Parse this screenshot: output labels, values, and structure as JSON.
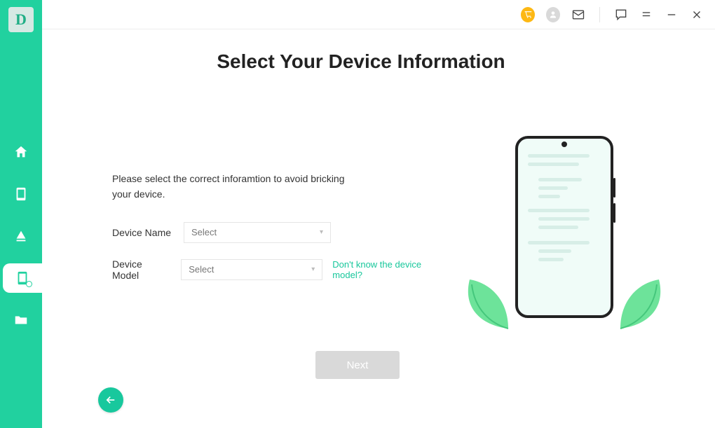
{
  "logo_letter": "D",
  "header": {
    "title": "Select Your Device Information"
  },
  "form": {
    "instruction": "Please select the correct inforamtion to avoid bricking your device.",
    "device_name_label": "Device Name",
    "device_name_value": "Select",
    "device_model_label": "Device Model",
    "device_model_value": "Select",
    "help_link_text": "Don't know the device model?",
    "next_label": "Next"
  },
  "sidebar": {
    "items": [
      "home",
      "phone",
      "cloud",
      "phone-alert",
      "folder"
    ],
    "active_index": 3
  },
  "titlebar_icons": [
    "cart",
    "user",
    "mail",
    "separator",
    "chat",
    "menu",
    "minimize",
    "close"
  ]
}
